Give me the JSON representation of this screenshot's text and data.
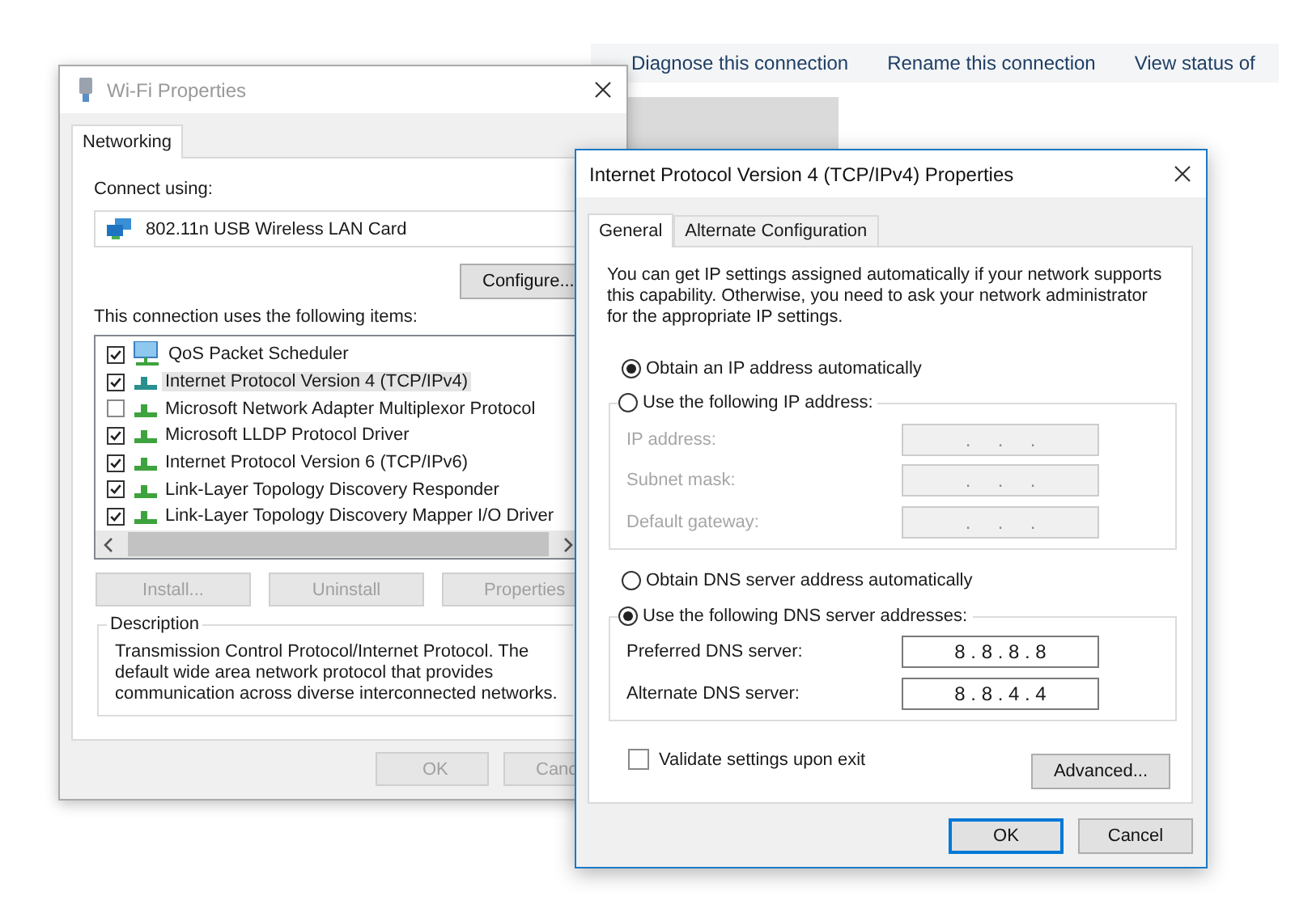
{
  "explorer_toolbar": {
    "links": [
      "Diagnose this connection",
      "Rename this connection",
      "View status of"
    ]
  },
  "wifi_properties": {
    "title": "Wi-Fi Properties",
    "active": false,
    "tabs": [
      {
        "label": "Networking",
        "selected": true
      }
    ],
    "connect_using_label": "Connect using:",
    "adapter": "802.11n USB Wireless LAN Card",
    "configure_button": "Configure...",
    "items_label": "This connection uses the following items:",
    "items": [
      {
        "kind": "service",
        "label": "QoS Packet Scheduler",
        "checked": true,
        "selected": false
      },
      {
        "kind": "protocol",
        "label": "Internet Protocol Version 4 (TCP/IPv4)",
        "checked": true,
        "selected": true
      },
      {
        "kind": "protocol",
        "label": "Microsoft Network Adapter Multiplexor Protocol",
        "checked": false,
        "selected": false
      },
      {
        "kind": "protocol",
        "label": "Microsoft LLDP Protocol Driver",
        "checked": true,
        "selected": false
      },
      {
        "kind": "protocol",
        "label": "Internet Protocol Version 6 (TCP/IPv6)",
        "checked": true,
        "selected": false
      },
      {
        "kind": "protocol",
        "label": "Link-Layer Topology Discovery Responder",
        "checked": true,
        "selected": false
      },
      {
        "kind": "protocol",
        "label": "Link-Layer Topology Discovery Mapper I/O Driver",
        "checked": true,
        "selected": false
      }
    ],
    "item_buttons": [
      {
        "label": "Install...",
        "disabled": true
      },
      {
        "label": "Uninstall",
        "disabled": true
      },
      {
        "label": "Properties",
        "disabled": true
      }
    ],
    "description": {
      "title": "Description",
      "text": "Transmission Control Protocol/Internet Protocol. The default wide area network protocol that provides communication across diverse interconnected networks."
    },
    "footer_buttons": [
      {
        "label": "OK",
        "disabled": true
      },
      {
        "label": "Canc",
        "disabled": true
      }
    ]
  },
  "ipv4_properties": {
    "title": "Internet Protocol Version 4 (TCP/IPv4) Properties",
    "active": true,
    "tabs": [
      {
        "label": "General",
        "selected": true
      },
      {
        "label": "Alternate Configuration",
        "selected": false
      }
    ],
    "intro": "You can get IP settings assigned automatically if your network supports this capability. Otherwise, you need to ask your network administrator for the appropriate IP settings.",
    "ip_auto_radio": {
      "label": "Obtain an IP address automatically",
      "selected": true
    },
    "ip_manual": {
      "radio": {
        "label": "Use the following IP address:",
        "selected": false
      },
      "fields": [
        {
          "label": "IP address:",
          "value": ".     .     .",
          "disabled": true
        },
        {
          "label": "Subnet mask:",
          "value": ".     .     .",
          "disabled": true
        },
        {
          "label": "Default gateway:",
          "value": ".     .     .",
          "disabled": true
        }
      ]
    },
    "dns_auto_radio": {
      "label": "Obtain DNS server address automatically",
      "selected": false
    },
    "dns_manual": {
      "radio": {
        "label": "Use the following DNS server addresses:",
        "selected": true
      },
      "fields": [
        {
          "label": "Preferred DNS server:",
          "value": "8 . 8 . 8 . 8",
          "disabled": false
        },
        {
          "label": "Alternate DNS server:",
          "value": "8 . 8 . 4 . 4",
          "disabled": false
        }
      ]
    },
    "validate_checkbox": {
      "label": "Validate settings upon exit",
      "checked": false
    },
    "advanced_button": "Advanced...",
    "footer_buttons": [
      {
        "label": "OK",
        "default": true
      },
      {
        "label": "Cancel",
        "default": false
      }
    ]
  }
}
